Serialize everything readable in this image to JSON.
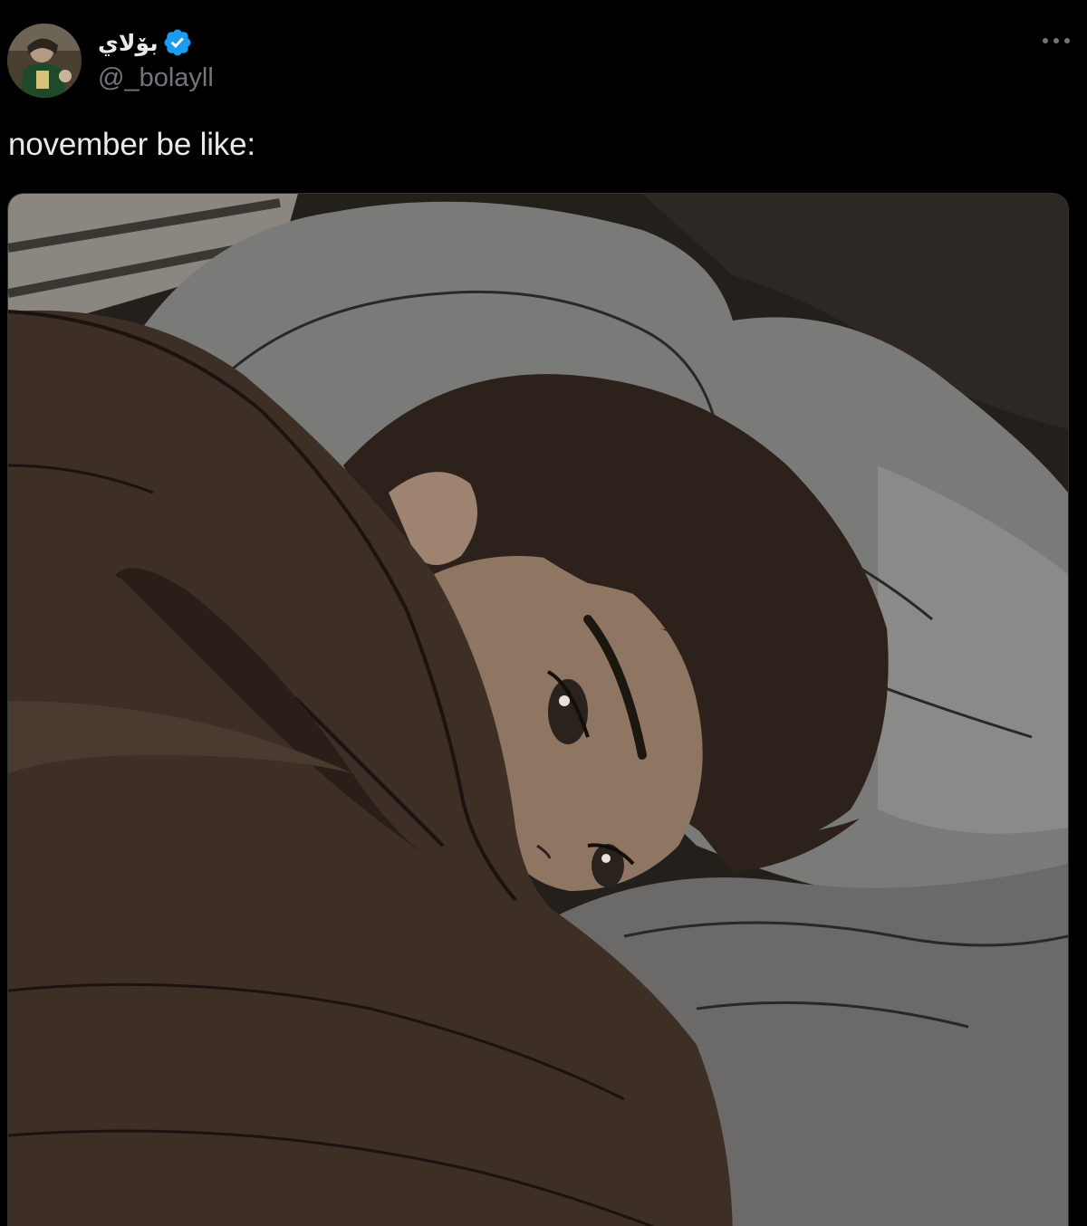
{
  "post": {
    "author": {
      "display_name": "بۆلاي",
      "handle": "@_bolayll",
      "verified": true,
      "verified_color": "#1d9bf0",
      "avatar_icon": "user-avatar-photo"
    },
    "more_icon": "more-horizontal-icon",
    "text": "november be like:",
    "media": {
      "type": "image",
      "description_icon": "anime-girl-in-bed-illustration"
    }
  },
  "colors": {
    "background": "#000000",
    "primary_text": "#e7e9ea",
    "secondary_text": "#71767b",
    "accent": "#1d9bf0"
  }
}
